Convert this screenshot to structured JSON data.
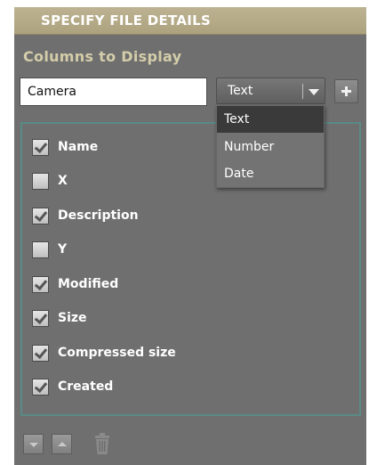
{
  "header": {
    "title": "SPECIFY FILE DETAILS"
  },
  "section": {
    "title": "Columns to Display"
  },
  "column_input": {
    "value": "Camera"
  },
  "type_select": {
    "selected": "Text",
    "options": [
      "Text",
      "Number",
      "Date"
    ]
  },
  "columns": [
    {
      "label": "Name",
      "checked": true
    },
    {
      "label": "X",
      "checked": false
    },
    {
      "label": "Description",
      "checked": true
    },
    {
      "label": "Y",
      "checked": false
    },
    {
      "label": "Modified",
      "checked": true
    },
    {
      "label": "Size",
      "checked": true
    },
    {
      "label": "Compressed size",
      "checked": true
    },
    {
      "label": "Created",
      "checked": true
    }
  ],
  "icons": {
    "add": "plus-icon",
    "move_down": "arrow-down-icon",
    "move_up": "arrow-up-icon",
    "delete": "trash-icon",
    "dropdown": "chevron-down-icon"
  },
  "colors": {
    "panel_bg": "#6f6f6f",
    "header_bg": "#b1a783",
    "section_title": "#d3cda9",
    "list_border": "#5a8a86",
    "selected_option": "#3a3a3a"
  }
}
